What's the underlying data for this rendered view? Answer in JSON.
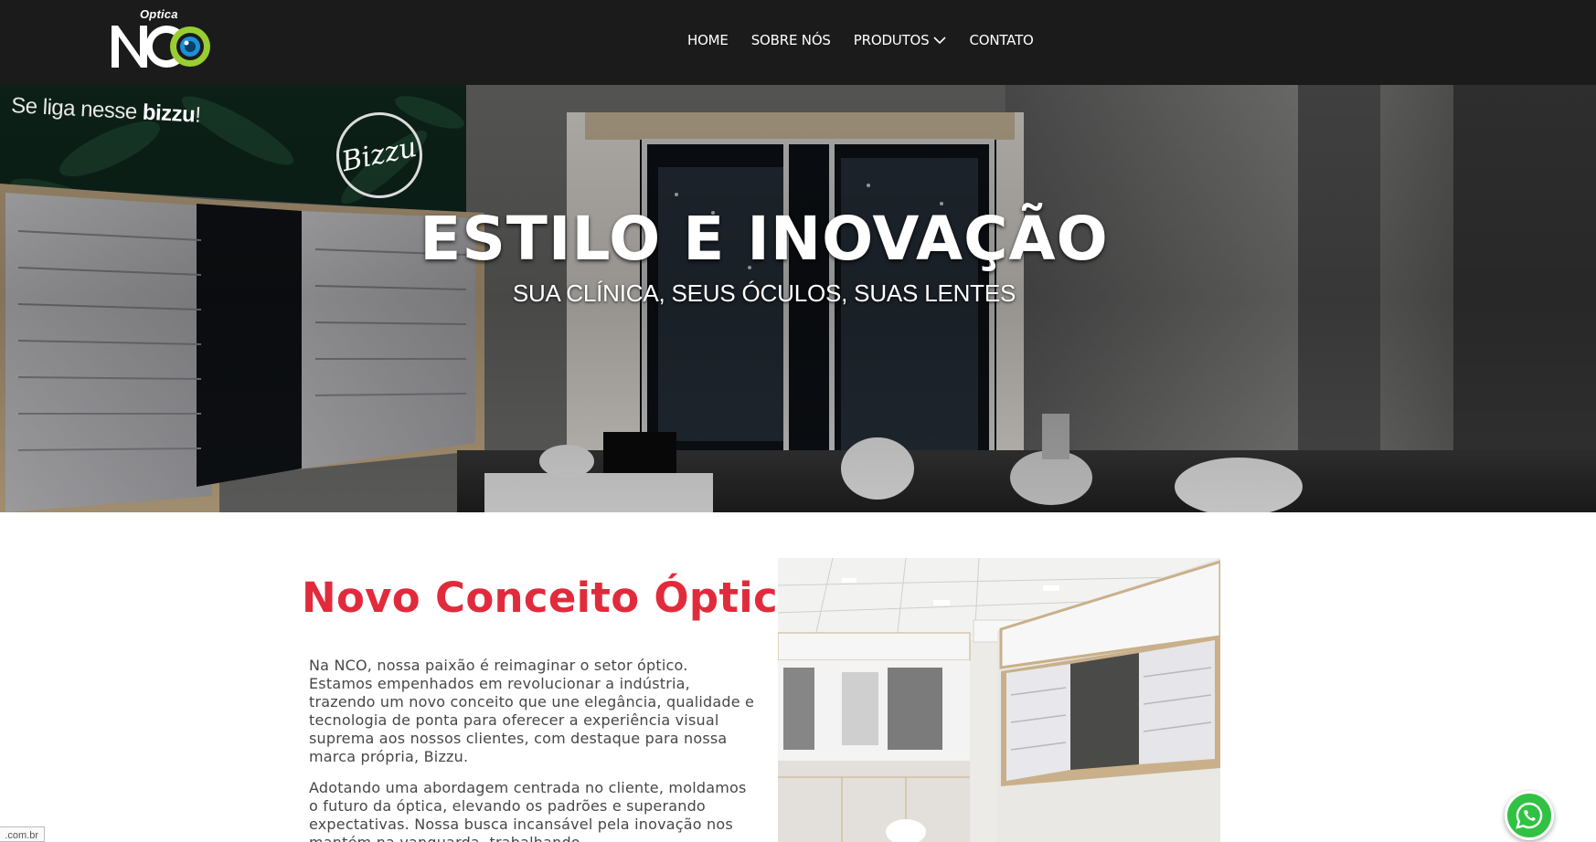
{
  "brand": {
    "small": "Optica",
    "name": "NCO",
    "accent": "#9acd32",
    "eye": "#1c8fd9"
  },
  "nav": {
    "items": [
      {
        "label": "HOME"
      },
      {
        "label": "SOBRE NÓS"
      },
      {
        "label": "PRODUTOS",
        "icon": "chevron-down-icon"
      },
      {
        "label": "CONTATO"
      }
    ]
  },
  "hero": {
    "title": "ESTILO E INOVAÇÃO",
    "subtitle": "SUA CLÍNICA, SEUS ÓCULOS, SUAS LENTES",
    "wall_text_plain": "Se liga nesse",
    "wall_text_bold": "bizzu",
    "wall_text_end": "!",
    "badge": "Bizzu"
  },
  "about": {
    "title": "Novo Conceito Óptico",
    "paragraphs": [
      "Na NCO, nossa paixão é reimaginar o setor óptico. Estamos empenhados em revolucionar a indústria, trazendo um novo conceito que une elegância, qualidade e tecnologia de ponta para oferecer a experiência visual suprema aos nossos clientes, com destaque para nossa marca própria, Bizzu.",
      "Adotando uma abordagem centrada no cliente, moldamos o futuro da óptica, elevando os padrões e superando expectativas. Nossa busca incansável pela inovação nos mantém na vanguarda, trabalhando"
    ]
  },
  "footer_tag": ".com.br",
  "colors": {
    "header_bg": "#1b1b1b",
    "title_red": "#e12b3c",
    "whatsapp": "#31c243"
  }
}
